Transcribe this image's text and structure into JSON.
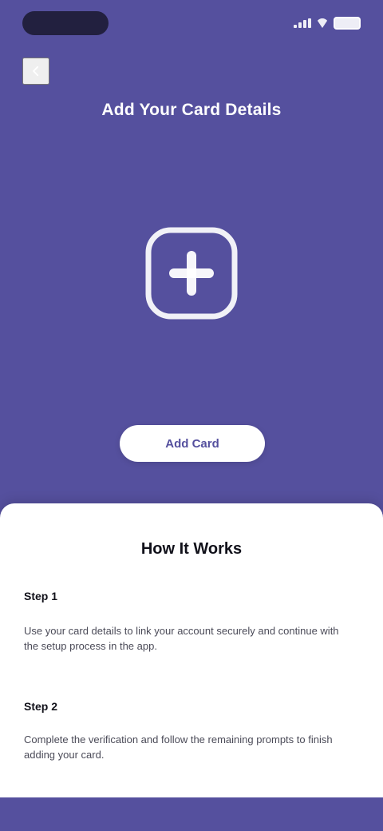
{
  "status_bar": {
    "time": "",
    "battery": ""
  },
  "header": {
    "title": "Add Your Card Details",
    "back_label": "Back"
  },
  "main": {
    "tile_label": "",
    "primary_action": "Add Card"
  },
  "sheet": {
    "title": "How It Works",
    "steps": [
      {
        "label": "Step 1",
        "text": "Use your card details to link your account securely and continue with the setup process in the app."
      },
      {
        "label": "Step 2",
        "text": "Complete the verification and follow the remaining prompts to finish adding your card."
      }
    ]
  },
  "colors": {
    "accent": "#55509e",
    "surface": "#ffffff",
    "text_primary": "#11111a",
    "text_secondary": "#4b4b58"
  },
  "icons": {
    "back": "back-arrow-icon",
    "add": "plus-square-icon",
    "signal": "signal-icon",
    "wifi": "wifi-icon",
    "battery": "battery-icon"
  }
}
